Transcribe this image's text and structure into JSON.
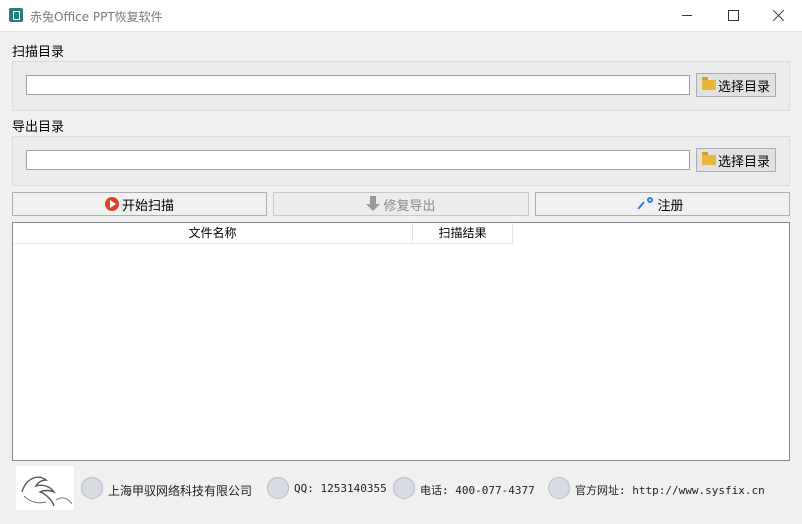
{
  "window": {
    "title": "赤兔Office PPT恢复软件"
  },
  "scan": {
    "label": "扫描目录",
    "path_value": "",
    "pick_label": "选择目录"
  },
  "export": {
    "label": "导出目录",
    "path_value": "",
    "pick_label": "选择目录"
  },
  "actions": {
    "start_label": "开始扫描",
    "repair_label": "修复导出",
    "register_label": "注册"
  },
  "table": {
    "columns": [
      "文件名称",
      "扫描结果"
    ],
    "rows": []
  },
  "footer": {
    "company": "上海甲驭网络科技有限公司",
    "qq": "QQ: 1253140355",
    "phone": "电话: 400-077-4377",
    "website": "官方网址: http://www.sysfix.cn"
  },
  "icons": {
    "app": "app-icon",
    "folder": "folder-icon",
    "start": "play-icon",
    "repair": "download-icon",
    "register": "key-icon"
  },
  "colors": {
    "accent_play": "#d8452b",
    "key_blue": "#2f7fd6",
    "folder": "#e8b63a"
  }
}
